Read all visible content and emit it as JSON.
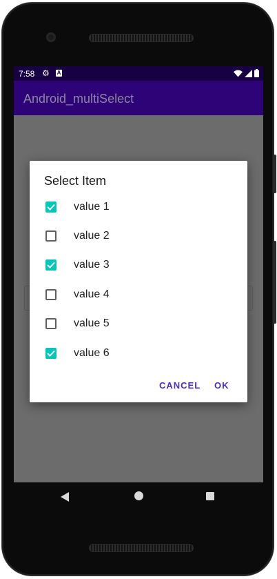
{
  "status_bar": {
    "time": "7:58",
    "icons": [
      "gear-icon",
      "a-notification-icon",
      "wifi-icon",
      "signal-icon",
      "battery-icon"
    ]
  },
  "app_bar": {
    "title": "Android_multiSelect"
  },
  "dialog": {
    "title": "Select Item",
    "options": [
      {
        "label": "value 1",
        "checked": true
      },
      {
        "label": "value 2",
        "checked": false
      },
      {
        "label": "value 3",
        "checked": true
      },
      {
        "label": "value 4",
        "checked": false
      },
      {
        "label": "value 5",
        "checked": false
      },
      {
        "label": "value 6",
        "checked": true
      }
    ],
    "cancel_label": "CANCEL",
    "ok_label": "OK"
  },
  "nav_bar": {
    "icons": [
      "back-icon",
      "home-icon",
      "recents-icon"
    ]
  },
  "colors": {
    "status_bar": "#180044",
    "app_bar": "#2e0378",
    "checkbox_checked": "#00c7b8",
    "dialog_button": "#4b2ad0",
    "scrim": "#6c6c6c"
  }
}
